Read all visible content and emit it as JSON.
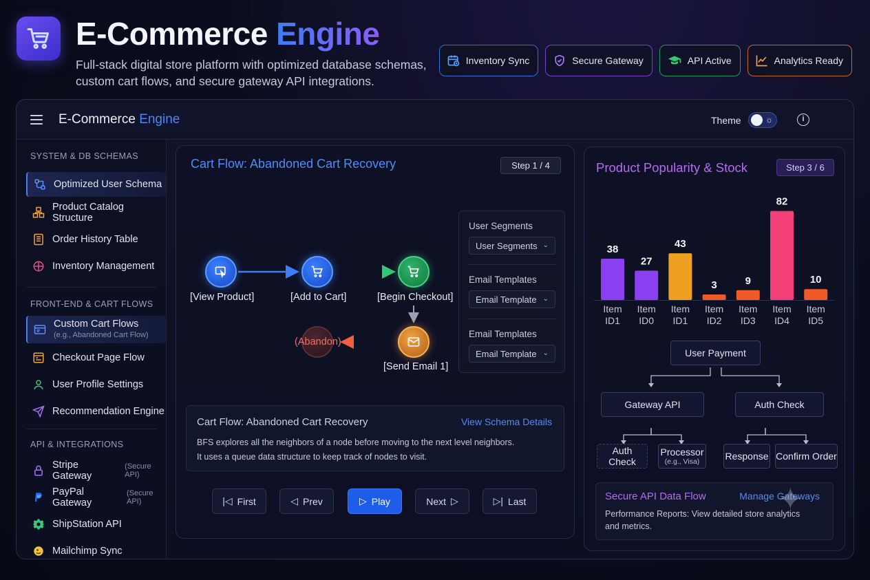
{
  "hero": {
    "title_part1": "E-Commerce",
    "title_part2": "Engine",
    "subtitle_line1": "Full-stack digital store platform with optimized database schemas,",
    "subtitle_line2": "custom cart flows, and secure gateway API integrations.",
    "badges": [
      {
        "label": "Inventory Sync",
        "icon": "calendar-sync-icon",
        "color": "#2f6fd6"
      },
      {
        "label": "Secure Gateway",
        "icon": "shield-check-icon",
        "color": "#7a3fd1"
      },
      {
        "label": "API Active",
        "icon": "graduation-cap-icon",
        "color": "#1f9a5a"
      },
      {
        "label": "Analytics Ready",
        "icon": "line-chart-icon",
        "color": "#c46a2a"
      }
    ]
  },
  "window": {
    "title_part1": "E-Commerce",
    "title_part2": "Engine",
    "theme_label": "Theme",
    "theme_toggle": "on"
  },
  "sidebar": {
    "sections": [
      {
        "title": "SYSTEM & DB SCHEMAS",
        "items": [
          {
            "label": "Optimized User Schema",
            "icon": "schema-icon",
            "active": true
          },
          {
            "label": "Product Catalog Structure",
            "icon": "boxes-icon"
          },
          {
            "label": "Order History Table",
            "icon": "document-list-icon"
          },
          {
            "label": "Inventory Management",
            "icon": "warehouse-icon"
          }
        ]
      },
      {
        "title": "FRONT-END & CART FLOWS",
        "items": [
          {
            "label": "Custom Cart Flows",
            "sublabel": "(e.g., Abandoned Cart Flow)",
            "icon": "browser-window-icon",
            "active": true
          },
          {
            "label": "Checkout Page Flow",
            "icon": "checkout-page-icon"
          },
          {
            "label": "User Profile Settings",
            "icon": "user-icon"
          },
          {
            "label": "Recommendation Engine",
            "icon": "send-icon"
          }
        ]
      },
      {
        "title": "API & INTEGRATIONS",
        "items": [
          {
            "label": "Stripe Gateway",
            "sublabel": "(Secure API)",
            "icon": "lock-icon"
          },
          {
            "label": "PayPal Gateway",
            "sublabel": "(Secure API)",
            "icon": "paypal-icon"
          },
          {
            "label": "ShipStation API",
            "icon": "gear-icon"
          },
          {
            "label": "Mailchimp Sync",
            "icon": "mailchimp-icon"
          }
        ]
      }
    ]
  },
  "flow_panel": {
    "title": "Cart Flow: Abandoned Cart Recovery",
    "step": "Step 1 / 4",
    "nodes": {
      "view_product": "[View Product]",
      "add_to_cart": "[Add to Cart]",
      "begin_checkout": "[Begin Checkout]",
      "send_email": "[Send Email 1]",
      "abandon": "(Abandon)"
    },
    "segments": {
      "group1_label": "User Segments",
      "group1_value": "User Segments",
      "group2_label": "Email Templates",
      "group2_value": "Email Template",
      "group3_label": "Email Templates",
      "group3_value": "Email Template"
    },
    "description": {
      "title": "Cart Flow: Abandoned Cart Recovery",
      "link": "View Schema Details",
      "line1": "BFS explores all the neighbors of a node before moving to the next level neighbors.",
      "line2": "It uses a queue data structure to keep track of nodes to visit."
    },
    "controls": {
      "first": "First",
      "prev": "Prev",
      "play": "Play",
      "next": "Next",
      "last": "Last"
    }
  },
  "chart_panel": {
    "title": "Product Popularity & Stock",
    "step": "Step 3 / 6"
  },
  "chart_data": {
    "type": "bar",
    "title": "Product Popularity & Stock",
    "categories": [
      "Item ID1",
      "Item ID0",
      "Item ID1",
      "Item ID2",
      "Item ID3",
      "Item ID4",
      "Item ID5"
    ],
    "values": [
      38,
      27,
      43,
      3,
      9,
      82,
      10
    ],
    "colors": [
      "#8a3ff0",
      "#8a3ff0",
      "#f0a020",
      "#f05a28",
      "#f05a28",
      "#f23f78",
      "#f05a28"
    ],
    "ylim": [
      0,
      90
    ],
    "grid": false
  },
  "tree": {
    "root": "User Payment",
    "gateway": "Gateway API",
    "auth": "Auth Check",
    "auth_check_leaf": "Auth Check",
    "processor": "Processor",
    "processor_sub": "(e.g., Visa)",
    "response": "Response",
    "confirm": "Confirm Order"
  },
  "api_box": {
    "title": "Secure API Data Flow",
    "link": "Manage Gateways",
    "text": "Performance Reports: View detailed store analytics and metrics."
  }
}
